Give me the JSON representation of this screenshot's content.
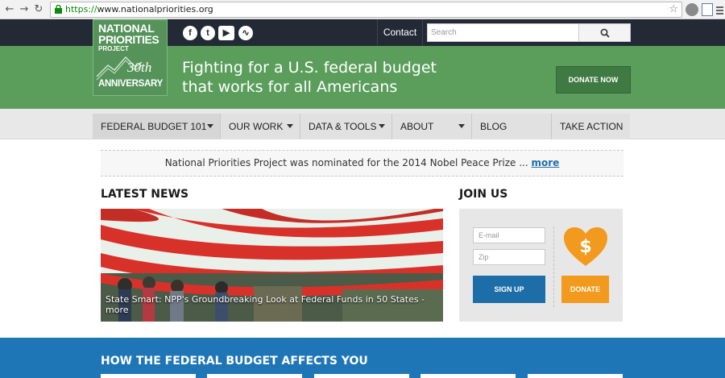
{
  "browser": {
    "url_scheme": "https://",
    "url_rest": "www.nationalpriorities.org"
  },
  "logo": {
    "line1": "NATIONAL",
    "line2": "PRIORITIES",
    "line3": "PROJECT",
    "line4": "30th",
    "line5": "ANNIVERSARY"
  },
  "header": {
    "social": [
      "facebook-icon",
      "twitter-icon",
      "youtube-icon",
      "rss-icon"
    ],
    "contact": "Contact",
    "search_placeholder": "Search",
    "tagline_line1": "Fighting for a U.S. federal budget",
    "tagline_line2": "that works for all Americans",
    "donate": "DONATE NOW"
  },
  "menu": [
    {
      "label": "FEDERAL BUDGET 101",
      "dropdown": true
    },
    {
      "label": "OUR WORK",
      "dropdown": true
    },
    {
      "label": "DATA & TOOLS",
      "dropdown": true
    },
    {
      "label": "ABOUT",
      "dropdown": true
    },
    {
      "label": "BLOG",
      "dropdown": false
    },
    {
      "label": "TAKE ACTION",
      "dropdown": false
    }
  ],
  "notice": {
    "text": "National Priorities Project was nominated for the 2014 Nobel Peace Prize ... ",
    "link": "more"
  },
  "news": {
    "heading": "LATEST NEWS",
    "caption": "State Smart: NPP's Groundbreaking Look at Federal Funds in 50 States - ",
    "caption_link": "more"
  },
  "join": {
    "heading": "JOIN US",
    "email_placeholder": "E-mail",
    "zip_placeholder": "Zip",
    "signup": "SIGN UP",
    "donate": "DONATE"
  },
  "affects": {
    "heading": "HOW THE FEDERAL BUDGET AFFECTS YOU"
  },
  "colors": {
    "dark": "#232a36",
    "green": "#5b9e5c",
    "blue": "#1f76b7",
    "orange": "#f29a1e"
  }
}
